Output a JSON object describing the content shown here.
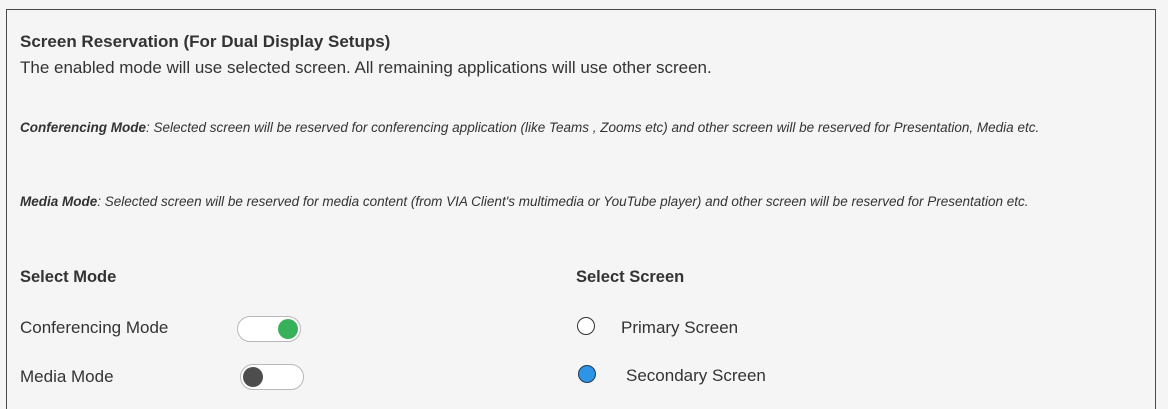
{
  "panel": {
    "title": "Screen Reservation (For Dual Display Setups)",
    "subtitle": "The enabled mode will use selected screen. All remaining applications will use other screen.",
    "conferencing_desc": {
      "term": "Conferencing Mode",
      "text": ": Selected screen will be reserved for conferencing application (like Teams , Zooms etc) and other screen will be reserved for Presentation, Media etc."
    },
    "media_desc": {
      "term": "Media Mode",
      "text": ": Selected screen will be reserved for media content (from VIA Client's multimedia or YouTube player) and other screen will be reserved for Presentation etc."
    }
  },
  "modes": {
    "heading": "Select Mode",
    "items": [
      {
        "label": "Conferencing Mode",
        "enabled": true
      },
      {
        "label": "Media Mode",
        "enabled": false
      }
    ]
  },
  "screens": {
    "heading": "Select Screen",
    "items": [
      {
        "label": "Primary Screen",
        "selected": false
      },
      {
        "label": "Secondary Screen",
        "selected": true
      }
    ]
  },
  "colors": {
    "toggle_on": "#38b25a",
    "toggle_off_knob": "#4d4d4d",
    "radio_selected": "#2d95e6"
  }
}
